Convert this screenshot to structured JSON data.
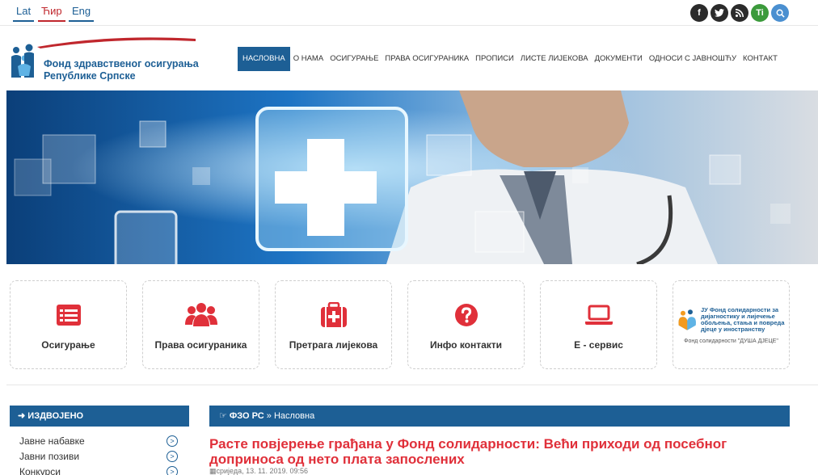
{
  "languages": [
    "Lat",
    "Ћир",
    "Eng"
  ],
  "social": {
    "facebook": "f",
    "twitter": "t",
    "rss": "rss",
    "ti": "Ti"
  },
  "logo": {
    "line1": "Фонд здравственог осигурања",
    "line2": "Републике Српске"
  },
  "nav": [
    {
      "label": "НАСЛОВНА",
      "active": true
    },
    {
      "label": "О НАМА"
    },
    {
      "label": "ОСИГУРАЊЕ"
    },
    {
      "label": "ПРАВА ОСИГУРАНИКА"
    },
    {
      "label": "ПРОПИСИ"
    },
    {
      "label": "ЛИСТЕ ЛИЈЕКОВА"
    },
    {
      "label": "ДОКУМЕНТИ"
    },
    {
      "label": "ОДНОСИ С ЈАВНОШЋУ"
    },
    {
      "label": "КОНТАКТ"
    }
  ],
  "tiles": [
    {
      "label": "Осигурање",
      "icon": "list-icon"
    },
    {
      "label": "Права осигураника",
      "icon": "users-icon"
    },
    {
      "label": "Претрага лијекова",
      "icon": "medkit-icon"
    },
    {
      "label": "Инфо контакти",
      "icon": "question-icon"
    },
    {
      "label": "Е - сервис",
      "icon": "laptop-icon"
    }
  ],
  "fund_banner": {
    "text1": "ЈУ Фонд солидарности за",
    "text2": "дијагностику и лијечење",
    "text3": "обољења, стања и повреда",
    "text4": "дјеце у иностранству",
    "caption": "Фонд солидарности \"ДУША ДЈЕЦЕ\""
  },
  "sidebar": {
    "title": "ИЗДВОЈЕНО",
    "items": [
      "Јавне набавке",
      "Јавни позиви",
      "Конкурси"
    ]
  },
  "breadcrumb": {
    "root": "ФЗО РС",
    "sep": "»",
    "current": "Насловна"
  },
  "article": {
    "headline": "Расте повјерење грађана у Фонд солидарности: Већи приходи од посебног доприноса од нето плата запослених",
    "date": "сриједа, 13. 11. 2019. 09:56"
  },
  "colors": {
    "brand_blue": "#1d5f95",
    "accent_red": "#e0303a"
  }
}
